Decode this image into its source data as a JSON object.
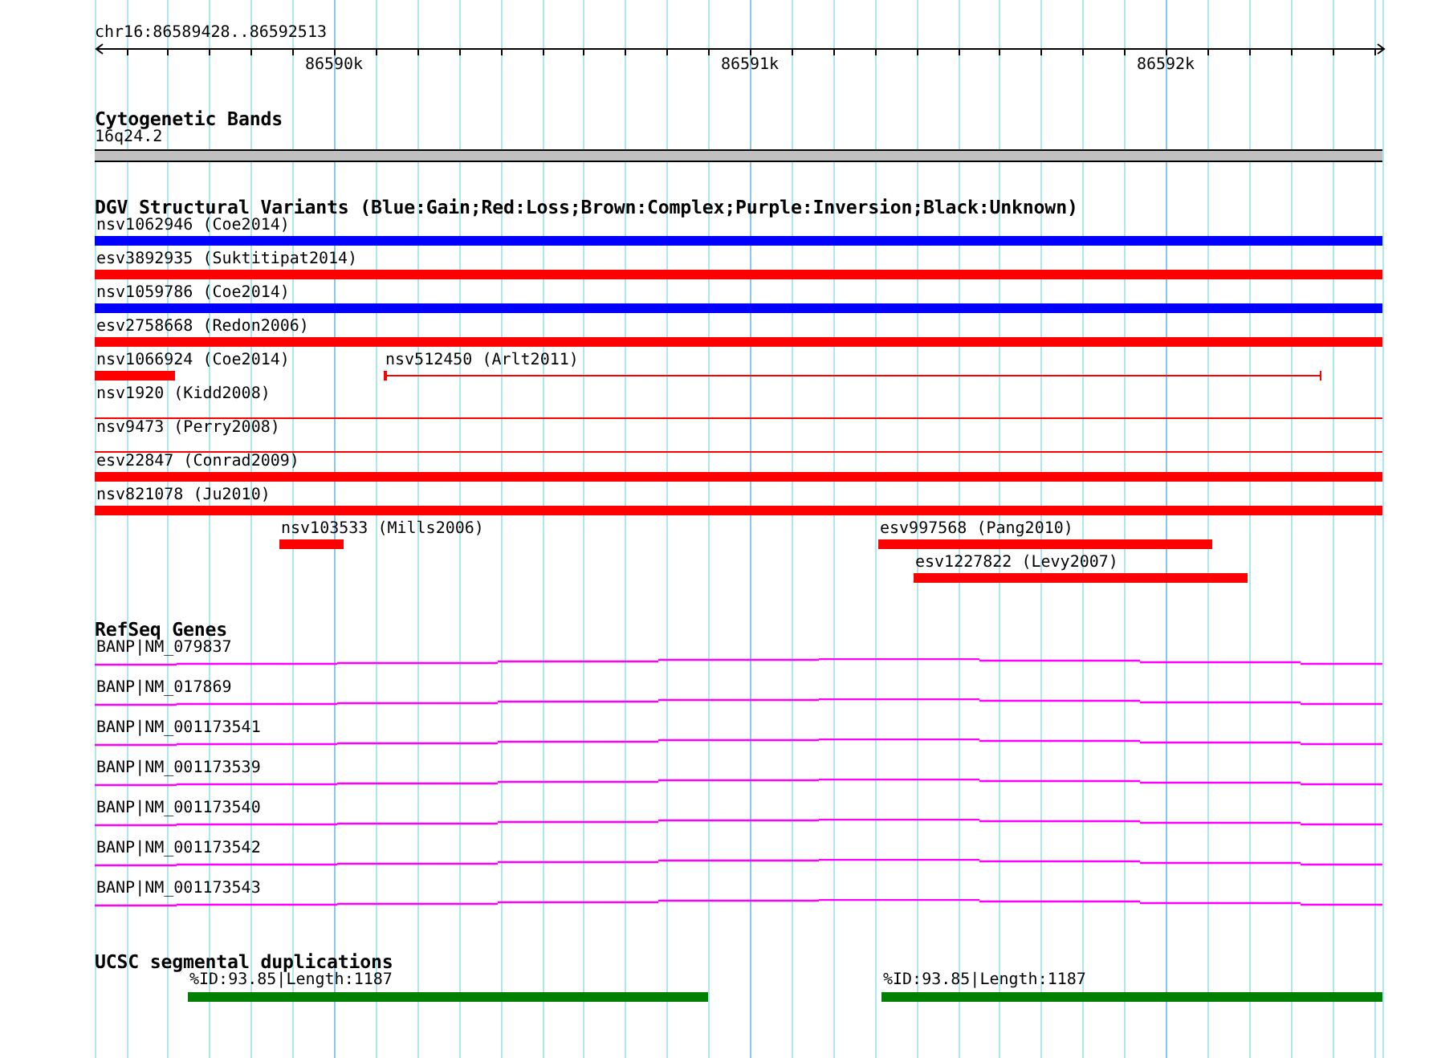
{
  "ruler": {
    "range": "chr16:86589428..86592513",
    "ticks": [
      "86590k",
      "86591k",
      "86592k"
    ]
  },
  "cytogenetic_bands": {
    "title": "Cytogenetic Bands",
    "bands": [
      {
        "label": "16q24.2"
      }
    ]
  },
  "dgv": {
    "title": "DGV Structural Variants (Blue:Gain;Red:Loss;Brown:Complex;Purple:Inversion;Black:Unknown)",
    "rows": [
      {
        "variants": [
          {
            "label": "nsv1062946 (Coe2014)",
            "kind": "bar",
            "color": "#0000ff"
          }
        ]
      },
      {
        "variants": [
          {
            "label": "esv3892935 (Suktitipat2014)",
            "kind": "bar",
            "color": "#ff0000"
          }
        ]
      },
      {
        "variants": [
          {
            "label": "nsv1059786 (Coe2014)",
            "kind": "bar",
            "color": "#0000ff"
          }
        ]
      },
      {
        "variants": [
          {
            "label": "esv2758668 (Redon2006)",
            "kind": "bar",
            "color": "#ff0000"
          }
        ]
      },
      {
        "variants": [
          {
            "label": "nsv1066924 (Coe2014)",
            "kind": "bar",
            "color": "#ff0000"
          },
          {
            "label": "nsv512450 (Arlt2011)",
            "kind": "interval",
            "color": "#ff0000"
          }
        ]
      },
      {
        "variants": [
          {
            "label": "nsv1920 (Kidd2008)",
            "kind": "line",
            "color": "#ff0000"
          }
        ]
      },
      {
        "variants": [
          {
            "label": "nsv9473 (Perry2008)",
            "kind": "line",
            "color": "#ff0000"
          }
        ]
      },
      {
        "variants": [
          {
            "label": "esv22847 (Conrad2009)",
            "kind": "bar",
            "color": "#ff0000"
          }
        ]
      },
      {
        "variants": [
          {
            "label": "nsv821078 (Ju2010)",
            "kind": "bar",
            "color": "#ff0000"
          }
        ]
      },
      {
        "variants": [
          {
            "label": "nsv103533 (Mills2006)",
            "kind": "bar",
            "color": "#ff0000"
          },
          {
            "label": "esv997568 (Pang2010)",
            "kind": "bar",
            "color": "#ff0000"
          }
        ]
      },
      {
        "variants": [
          {
            "label": "esv1227822 (Levy2007)",
            "kind": "bar",
            "color": "#ff0000"
          }
        ]
      }
    ]
  },
  "refseq": {
    "title": "RefSeq Genes",
    "genes": [
      {
        "label": "BANP|NM_079837"
      },
      {
        "label": "BANP|NM_017869"
      },
      {
        "label": "BANP|NM_001173541"
      },
      {
        "label": "BANP|NM_001173539"
      },
      {
        "label": "BANP|NM_001173540"
      },
      {
        "label": "BANP|NM_001173542"
      },
      {
        "label": "BANP|NM_001173543"
      }
    ]
  },
  "segmental_duplications": {
    "title": "UCSC segmental duplications",
    "items": [
      {
        "label": "%ID:93.85|Length:1187"
      },
      {
        "label": "%ID:93.85|Length:1187"
      }
    ]
  }
}
